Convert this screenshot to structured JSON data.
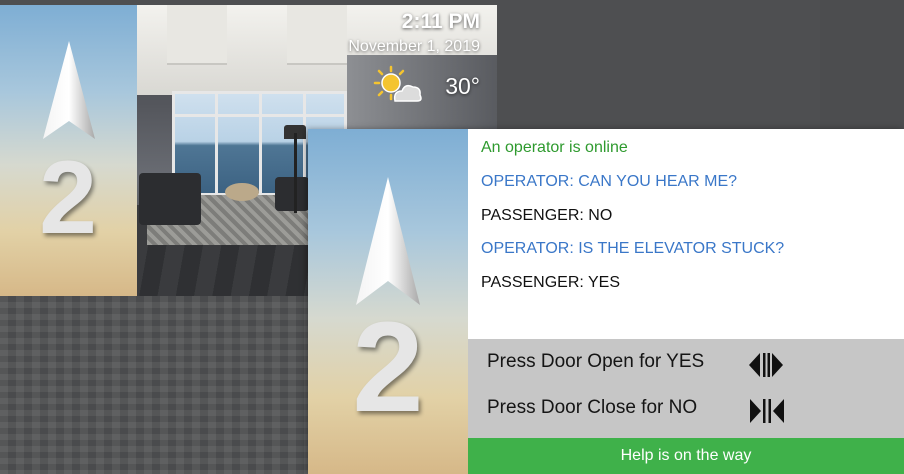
{
  "back_screen": {
    "floor_number": "2",
    "time": "2:11 PM",
    "date": "November 1, 2019",
    "temperature": "30°",
    "weather_icon": "partly-sunny-icon"
  },
  "front_screen": {
    "floor_number": "2",
    "chat": {
      "status": "An operator is online",
      "messages": [
        {
          "speaker": "operator",
          "text": "OPERATOR: CAN YOU HEAR ME?"
        },
        {
          "speaker": "passenger",
          "text": "PASSENGER: NO"
        },
        {
          "speaker": "operator",
          "text": "OPERATOR: IS THE ELEVATOR STUCK?"
        },
        {
          "speaker": "passenger",
          "text": "PASSENGER: YES"
        }
      ]
    },
    "prompts": {
      "yes": "Press Door Open for YES",
      "no": "Press Door Close for NO"
    },
    "status_bar": "Help is on the way"
  },
  "colors": {
    "operator_online": "#2e9a2e",
    "operator_text": "#3a77c8",
    "passenger_text": "#111111",
    "status_bar_bg": "#3fb14a",
    "prompt_bg": "#c6c6c6",
    "background": "#4e4f51"
  }
}
